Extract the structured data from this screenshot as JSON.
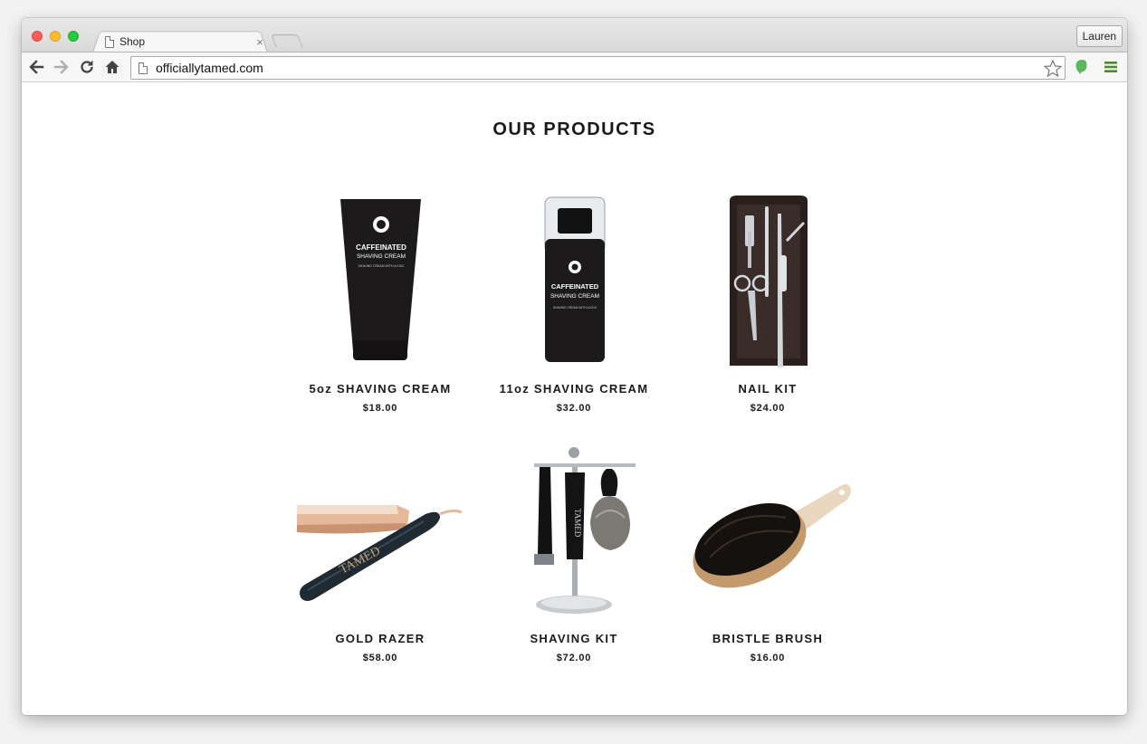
{
  "browser": {
    "tab_title": "Shop",
    "tab_close": "×",
    "profile_name": "Lauren",
    "url": "officiallytamed.com",
    "icons": [
      "back-icon",
      "forward-icon",
      "reload-icon",
      "home-icon",
      "page-icon",
      "star-icon",
      "evernote-icon",
      "menu-icon"
    ]
  },
  "page": {
    "heading": "OUR PRODUCTS",
    "products": [
      {
        "name": "5oz SHAVING CREAM",
        "price": "$18.00",
        "label_line1": "CAFFEINATED",
        "label_line2": "SHAVING CREAM",
        "label_line3": "SHAVING CREAM WITH A KICK"
      },
      {
        "name": "11oz SHAVING CREAM",
        "price": "$32.00",
        "label_line1": "CAFFEINATED",
        "label_line2": "SHAVING CREAM",
        "label_line3": "SHAVING CREAM WITH A KICK"
      },
      {
        "name": "NAIL KIT",
        "price": "$24.00"
      },
      {
        "name": "GOLD RAZER",
        "price": "$58.00",
        "engraving": "TAMED"
      },
      {
        "name": "SHAVING KIT",
        "price": "$72.00",
        "engraving": "TAMED"
      },
      {
        "name": "BRISTLE BRUSH",
        "price": "$16.00"
      }
    ]
  },
  "colors": {
    "accent_green": "#5cb85c",
    "product_black": "#1c1a1a",
    "rose_gold": "#e3b89b"
  }
}
